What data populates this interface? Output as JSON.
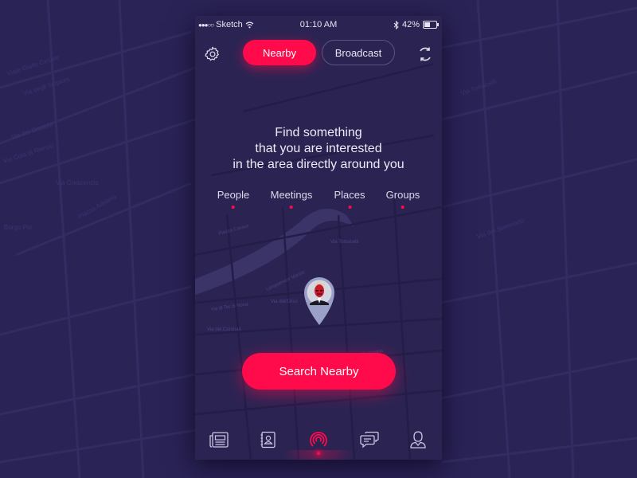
{
  "colors": {
    "background": "#2a2356",
    "phone_bg": "#2b2453",
    "accent": "#ff0a4a",
    "text": "#eceaf6",
    "icon": "#c9c6e0"
  },
  "status_bar": {
    "signal": "●●●○○",
    "carrier": "Sketch",
    "time": "01:10 AM",
    "battery_percent": "42%",
    "battery_level": 0.42
  },
  "header": {
    "settings_icon": "gear-icon",
    "tabs": [
      {
        "label": "Nearby",
        "active": true
      },
      {
        "label": "Broadcast",
        "active": false
      }
    ],
    "refresh_icon": "refresh-icon"
  },
  "main": {
    "headline": [
      "Find something",
      "that you are interested",
      "in the area directly around you"
    ],
    "categories": [
      "People",
      "Meetings",
      "Places",
      "Groups"
    ],
    "user_pin": "user-avatar-pin",
    "search_button": "Search Nearby"
  },
  "tabbar": {
    "items": [
      {
        "icon": "news-icon",
        "active": false
      },
      {
        "icon": "contacts-icon",
        "active": false
      },
      {
        "icon": "broadcast-icon",
        "active": true
      },
      {
        "icon": "chat-icon",
        "active": false
      },
      {
        "icon": "profile-icon",
        "active": false
      }
    ]
  },
  "map_labels": [
    "Viale Giulio Cesare",
    "Via degli Scipioni",
    "Via dei Gracchi",
    "Via Cola di Rienzo",
    "Via Crescenzio",
    "Piazza Adriana",
    "Borgo Pio",
    "Lungotevere Marzio",
    "Via dei Coronari",
    "Via Tomacelli",
    "Via del Seminario",
    "Piazza Cavour",
    "Via dell'Orso",
    "Via di Tor di Nona"
  ]
}
